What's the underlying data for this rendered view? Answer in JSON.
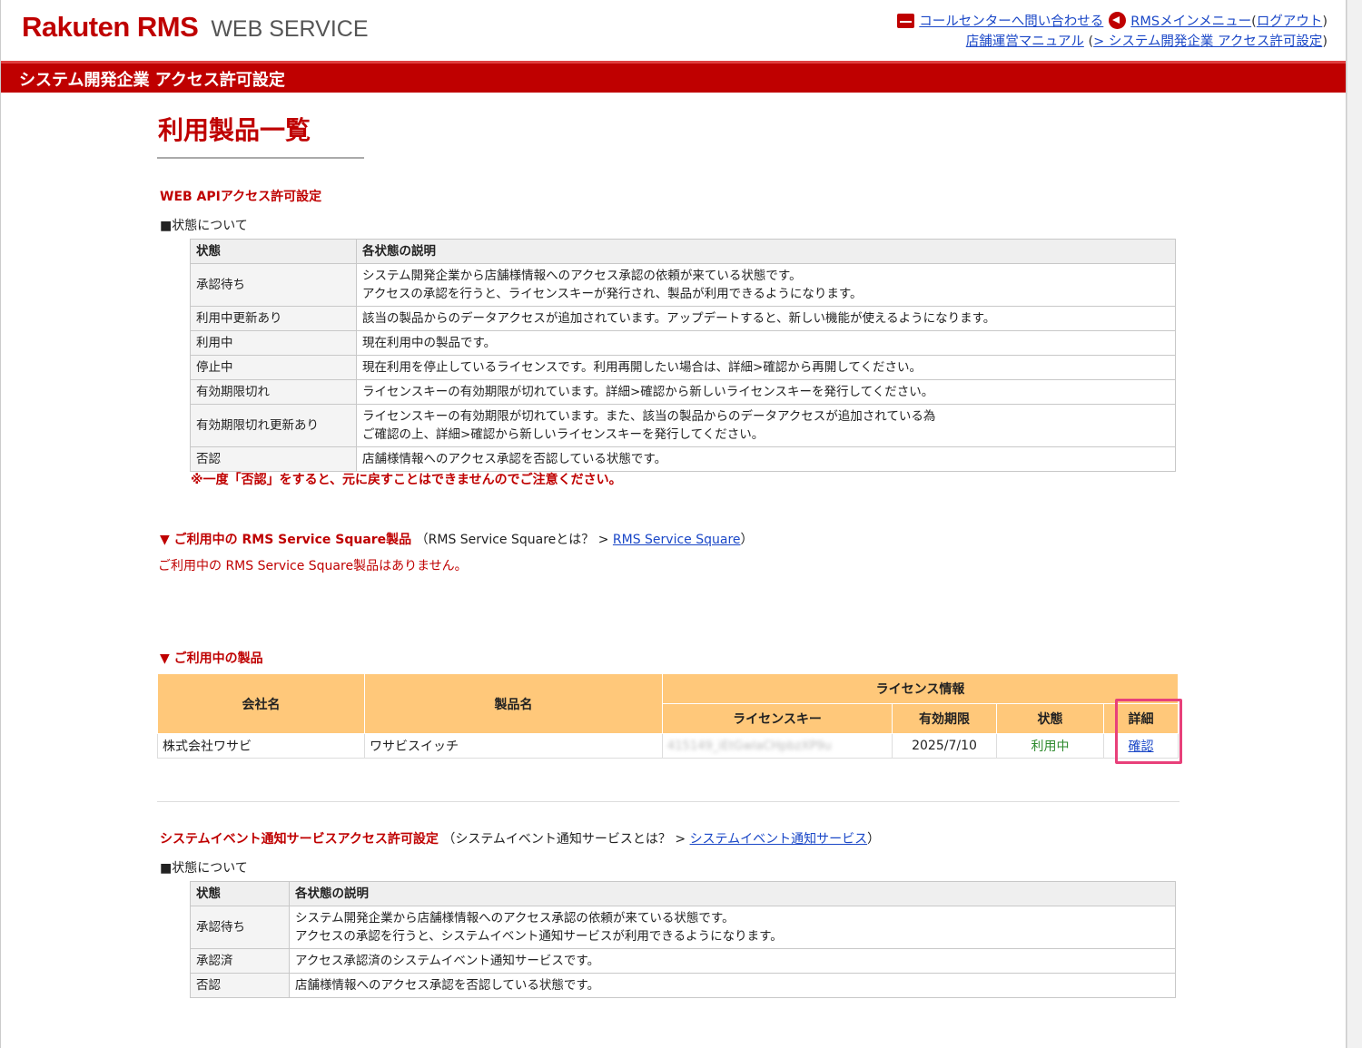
{
  "header": {
    "logo_brand": "Rakuten RMS",
    "logo_service": "WEB SERVICE",
    "callcenter_link": "コールセンターへ問い合わせる",
    "rms_menu_link": "RMSメインメニュー",
    "logout_link": "ログアウト",
    "manual_link": "店舗運営マニュアル",
    "manual_sub_link": "> システム開発企業 アクセス許可設定"
  },
  "redbar_title": "システム開発企業 アクセス許可設定",
  "page_title": "利用製品一覧",
  "webapi": {
    "heading": "WEB APIアクセス許可設定",
    "status_label": "■状態について",
    "col_state": "状態",
    "col_desc": "各状態の説明",
    "rows": [
      {
        "state": "承認待ち",
        "desc1": "システム開発企業から店舗様情報へのアクセス承認の依頼が来ている状態です。",
        "desc2": "アクセスの承認を行うと、ライセンスキーが発行され、製品が利用できるようになります。"
      },
      {
        "state": "利用中更新あり",
        "desc1": "該当の製品からのデータアクセスが追加されています。アップデートすると、新しい機能が使えるようになります。",
        "desc2": ""
      },
      {
        "state": "利用中",
        "desc1": "現在利用中の製品です。",
        "desc2": ""
      },
      {
        "state": "停止中",
        "desc1": "現在利用を停止しているライセンスです。利用再開したい場合は、詳細>確認から再開してください。",
        "desc2": ""
      },
      {
        "state": "有効期限切れ",
        "desc1": "ライセンスキーの有効期限が切れています。詳細>確認から新しいライセンスキーを発行してください。",
        "desc2": ""
      },
      {
        "state": "有効期限切れ更新あり",
        "desc1": "ライセンスキーの有効期限が切れています。また、該当の製品からのデータアクセスが追加されている為",
        "desc2": "ご確認の上、詳細>確認から新しいライセンスキーを発行してください。"
      },
      {
        "state": "否認",
        "desc1": "店舗様情報へのアクセス承認を否認している状態です。",
        "desc2": ""
      }
    ],
    "warning": "※一度「否認」をすると、元に戻すことはできませんのでご注意ください。"
  },
  "square": {
    "heading": "▼ ご利用中の RMS Service Square製品",
    "about_prefix": "（RMS Service Squareとは？ > ",
    "about_link": "RMS Service Square",
    "about_suffix": "）",
    "empty": "ご利用中の RMS Service Square製品はありません。"
  },
  "products": {
    "heading": "▼ ご利用中の製品",
    "col_company": "会社名",
    "col_product": "製品名",
    "col_license": "ライセンス情報",
    "col_key": "ライセンスキー",
    "col_expiry": "有効期限",
    "col_status": "状態",
    "col_detail": "詳細",
    "row": {
      "company": "株式会社ワサビ",
      "product": "ワサビスイッチ",
      "key": "415149_iEtGwlaCHpbzXP9u",
      "expiry": "2025/7/10",
      "status": "利用中",
      "detail": "確認"
    }
  },
  "event": {
    "heading": "システムイベント通知サービスアクセス許可設定",
    "about_prefix": "（システムイベント通知サービスとは？ > ",
    "about_link": "システムイベント通知サービス",
    "about_suffix": "）",
    "status_label": "■状態について",
    "col_state": "状態",
    "col_desc": "各状態の説明",
    "rows": [
      {
        "state": "承認待ち",
        "desc1": "システム開発企業から店舗様情報へのアクセス承認の依頼が来ている状態です。",
        "desc2": "アクセスの承認を行うと、システムイベント通知サービスが利用できるようになります。"
      },
      {
        "state": "承認済",
        "desc1": "アクセス承認済のシステムイベント通知サービスです。",
        "desc2": ""
      },
      {
        "state": "否認",
        "desc1": "店舗様情報へのアクセス承認を否認している状態です。",
        "desc2": ""
      }
    ]
  },
  "colors": {
    "brand_red": "#bf0000",
    "table_header_orange": "#ffc87a",
    "link_blue": "#1a47c7",
    "status_green": "#2d8a2d",
    "highlight_pink": "#e8407a"
  }
}
